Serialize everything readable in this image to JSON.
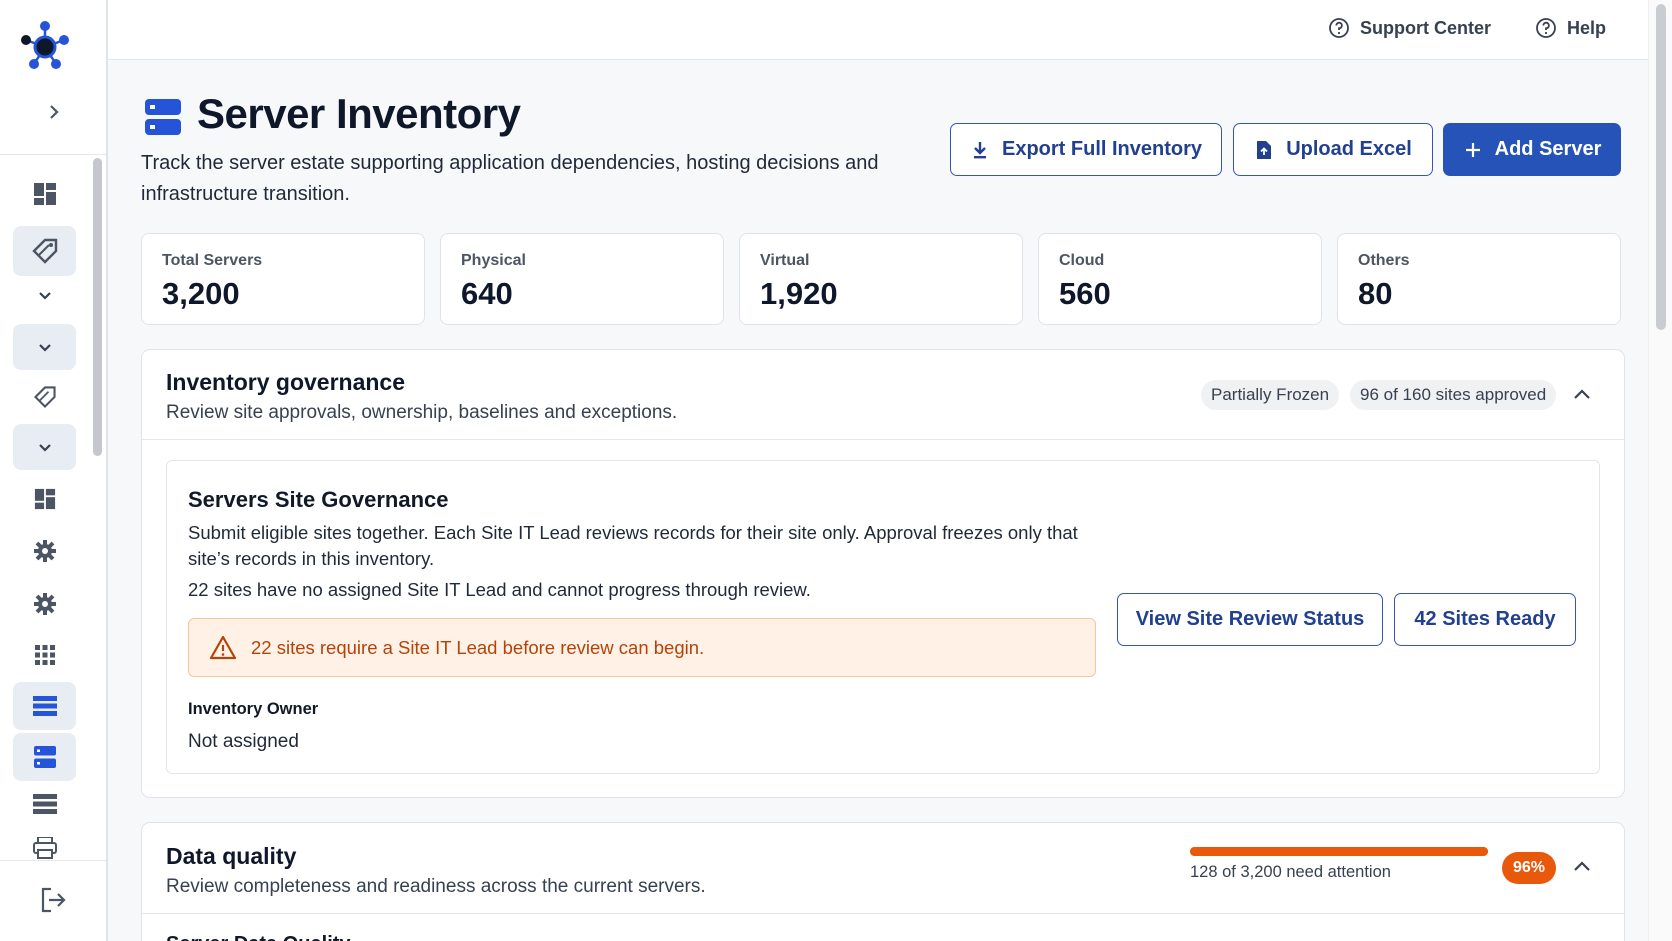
{
  "topbar": {
    "support_label": "Support Center",
    "help_label": "Help"
  },
  "header": {
    "title": "Server Inventory",
    "subtitle": "Track the server estate supporting application dependencies, hosting decisions and infrastructure transition.",
    "actions": {
      "export_label": "Export Full Inventory",
      "upload_label": "Upload Excel",
      "add_label": "Add Server"
    }
  },
  "stats": [
    {
      "label": "Total Servers",
      "value": "3,200"
    },
    {
      "label": "Physical",
      "value": "640"
    },
    {
      "label": "Virtual",
      "value": "1,920"
    },
    {
      "label": "Cloud",
      "value": "560"
    },
    {
      "label": "Others",
      "value": "80"
    }
  ],
  "governance": {
    "title": "Inventory governance",
    "subtitle": "Review site approvals, ownership, baselines and exceptions.",
    "status_pill": "Partially Frozen",
    "approval_pill": "96 of 160 sites approved",
    "site": {
      "title": "Servers Site Governance",
      "description": "Submit eligible sites together. Each Site IT Lead reviews records for their site only. Approval freezes only that site’s records in this inventory.",
      "note": "22 sites have no assigned Site IT Lead and cannot progress through review.",
      "warning": "22 sites require a Site IT Lead before review can begin.",
      "owner_label": "Inventory Owner",
      "owner_value": "Not assigned",
      "view_status_label": "View Site Review Status",
      "sites_ready_label": "42 Sites Ready"
    }
  },
  "data_quality": {
    "title": "Data quality",
    "subtitle": "Review completeness and readiness across the current servers.",
    "progress_text": "128 of 3,200 need attention",
    "progress_fraction": 1.0,
    "percent_badge": "96%",
    "section_title": "Server Data Quality"
  },
  "colors": {
    "primary": "#2553b8",
    "accent_blue": "#2554d8",
    "warning_bg": "#fff1e6",
    "warning_text": "#b4430a",
    "progress": "#e8590c"
  },
  "icons": {
    "logo": "network-logo-icon",
    "title": "server-stack-icon",
    "export": "download-icon",
    "upload": "file-upload-icon",
    "add": "plus-icon",
    "warning": "warning-triangle-icon",
    "help": "question-circle-icon"
  }
}
